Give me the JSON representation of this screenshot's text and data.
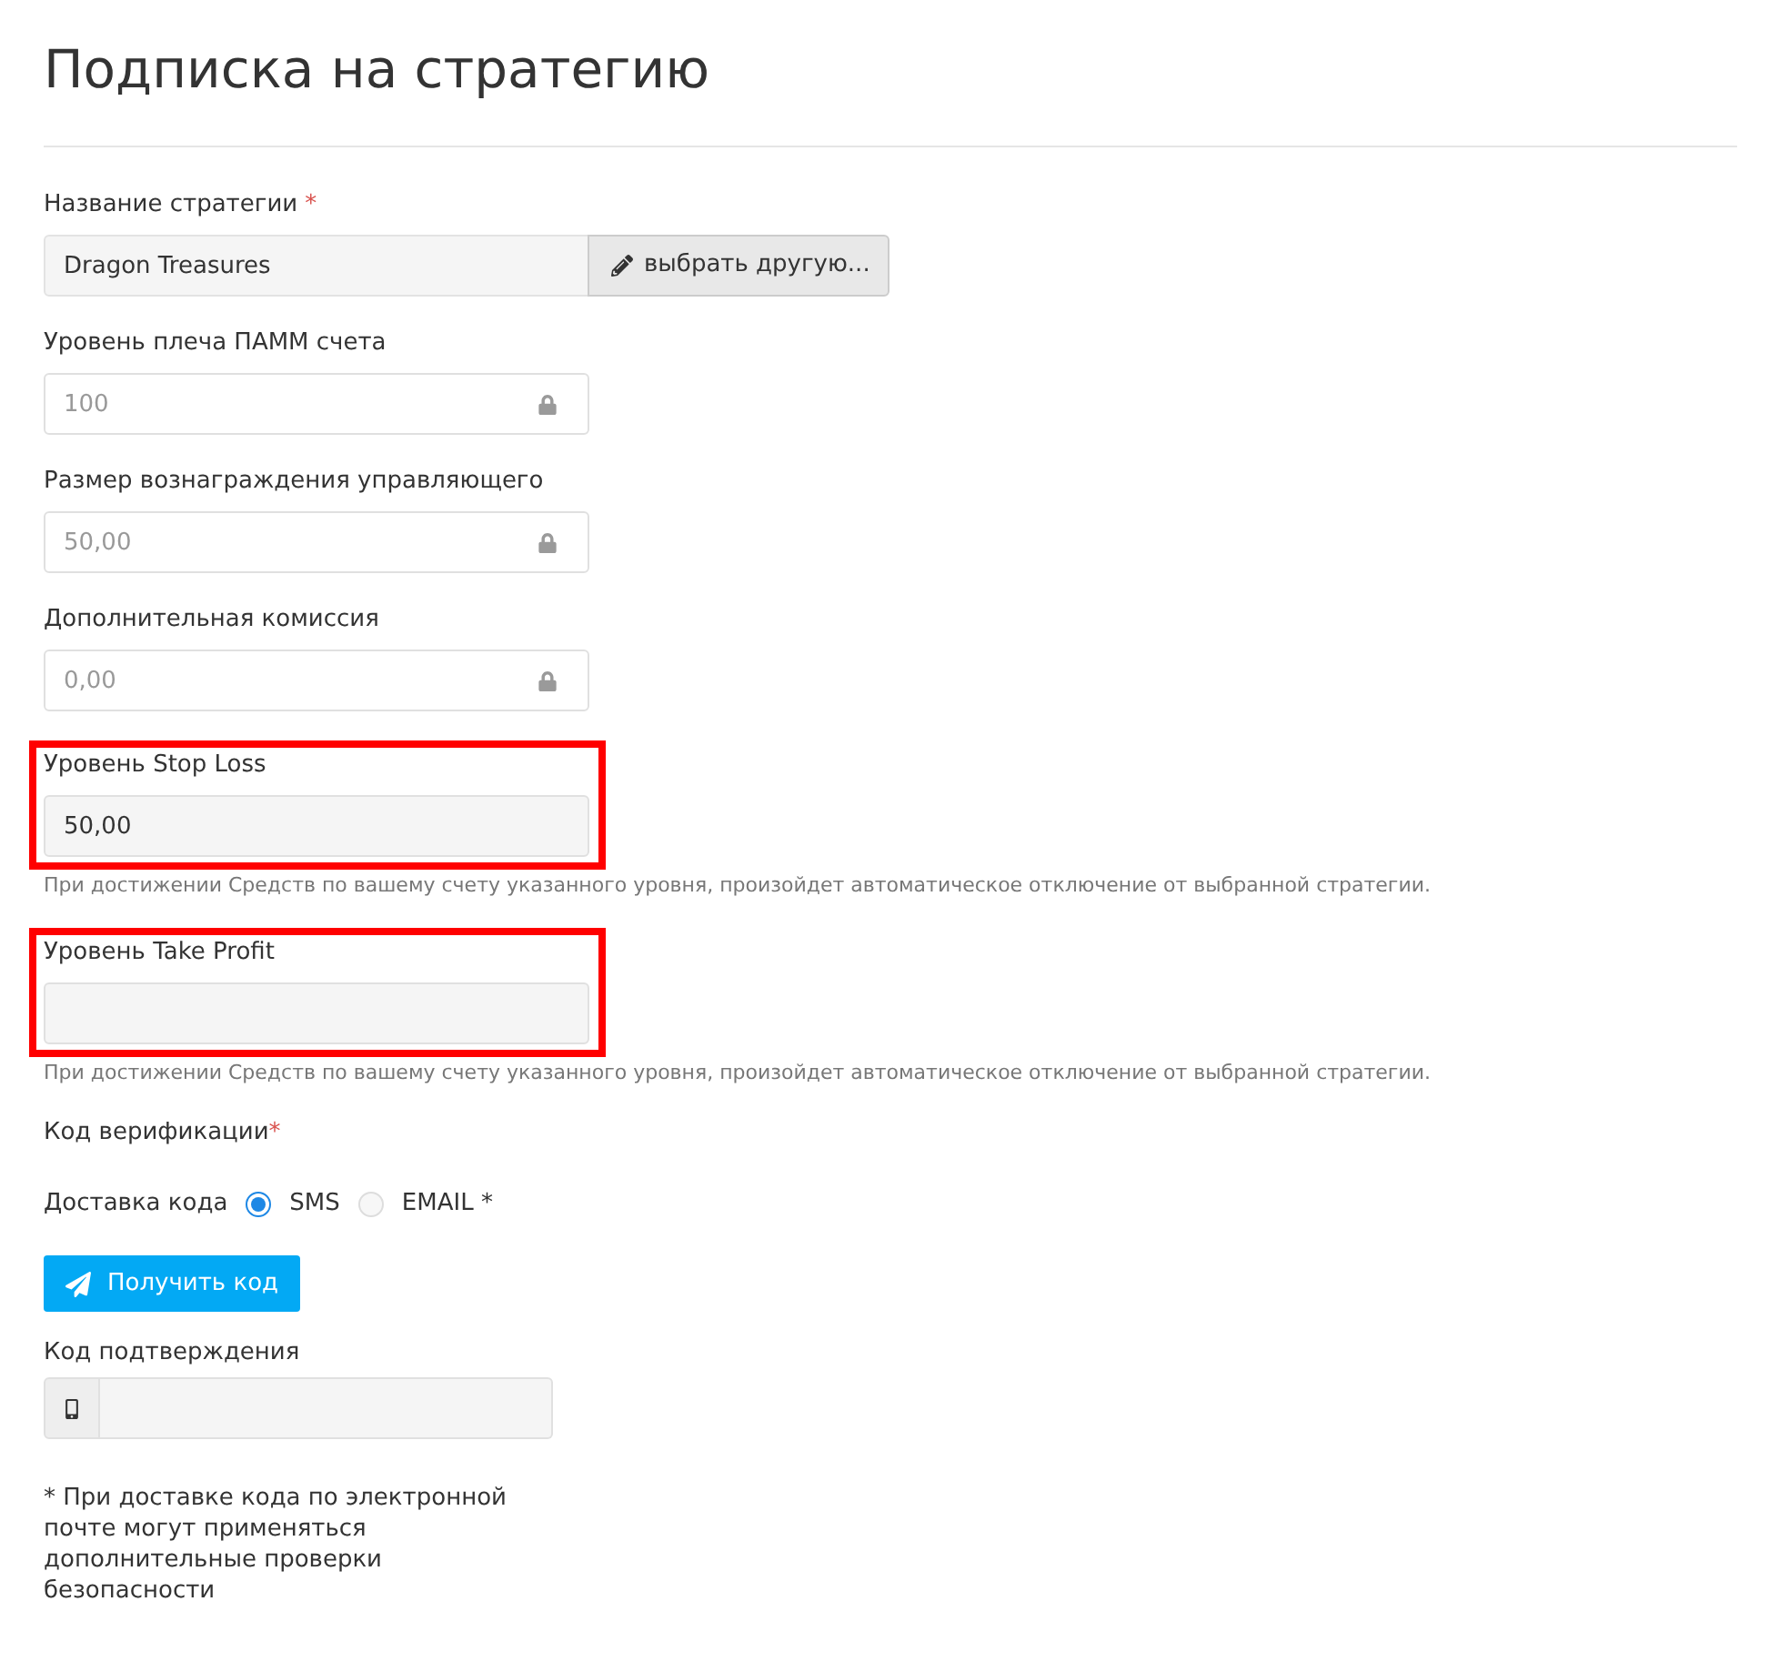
{
  "title": "Подписка на стратегию",
  "fields": [
    {
      "kind": "picker",
      "label": "Название стратегии",
      "required_mark": "*",
      "value": "Dragon Treasures",
      "button": "выбрать другую...",
      "highlighted": false
    },
    {
      "kind": "locked",
      "label": "Уровень плеча ПАММ счета",
      "value": "100",
      "highlighted": false
    },
    {
      "kind": "locked",
      "label": "Размер вознаграждения управляющего",
      "value": "50,00",
      "highlighted": false
    },
    {
      "kind": "locked",
      "label": "Дополнительная комиссия",
      "value": "0,00",
      "highlighted": false
    },
    {
      "kind": "text",
      "label": "Уровень Stop Loss",
      "value": "50,00",
      "highlighted": true,
      "help": "При достижении Средств по вашему счету указанного уровня, произойдет автоматическое отключение от выбранной стратегии."
    },
    {
      "kind": "text",
      "label": "Уровень Take Profit",
      "highlighted": true,
      "help": "При достижении Средств по вашему счету указанного уровня, произойдет автоматическое отключение от выбранной стратегии."
    }
  ],
  "verification": {
    "label": "Код верификации",
    "required_mark": "*",
    "delivery_label": "Доставка кода",
    "options": [
      {
        "label": "SMS",
        "selected": true
      },
      {
        "label": "EMAIL *",
        "selected": false
      }
    ],
    "button": "Получить код",
    "code_label": "Код подтверждения",
    "footnote": "* При доставке кода по электронной почте могут применяться дополнительные проверки безопасности"
  }
}
